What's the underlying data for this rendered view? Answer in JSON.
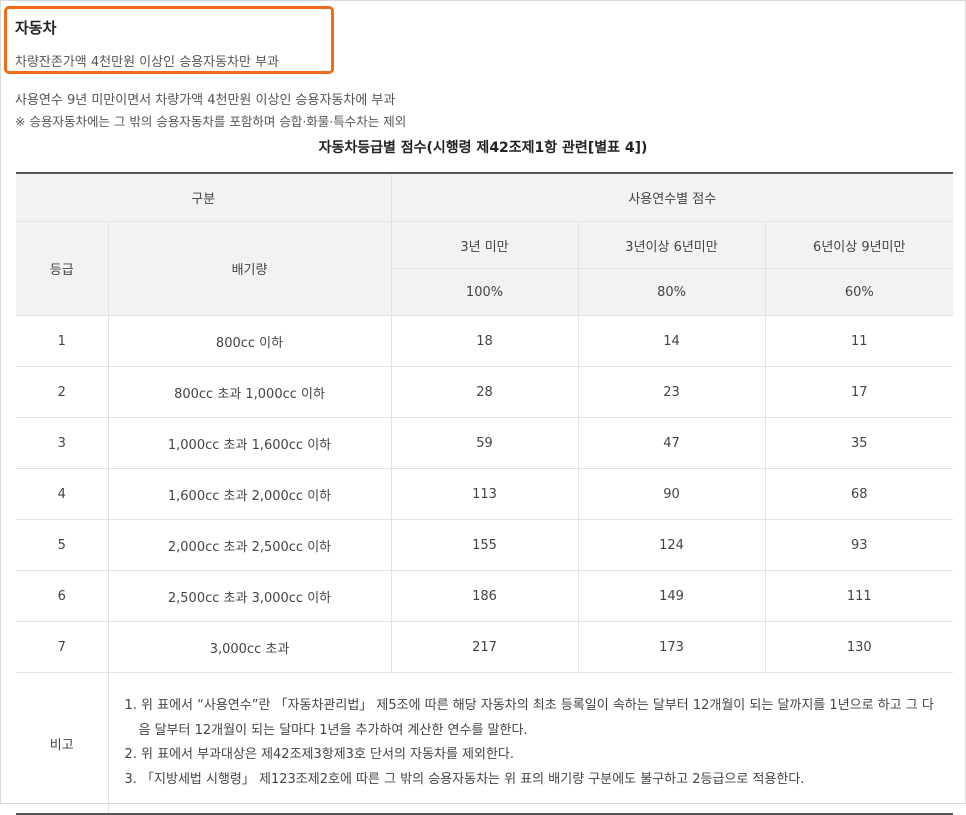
{
  "header": {
    "title": "자동차",
    "subtitle": "차량잔존가액 4천만원 이상인 승용자동차만 부과"
  },
  "description": {
    "line1": "사용연수 9년 미만이면서 차량가액 4천만원 이상인 승용자동차에 부과",
    "line2": "※ 승용자동차에는 그 밖의 승용자동차를 포함하며 승합·화물·특수차는 제외"
  },
  "table": {
    "title": "자동차등급별 점수(시행령 제42조제1항 관련[별표 4])",
    "header_category": "구분",
    "header_scores": "사용연수별 점수",
    "header_grade": "등급",
    "header_displacement": "배기량",
    "periods": [
      "3년 미만",
      "3년이상 6년미만",
      "6년이상 9년미만"
    ],
    "rates": [
      "100%",
      "80%",
      "60%"
    ],
    "rows": [
      {
        "grade": "1",
        "displacement": "800cc 이하",
        "s1": "18",
        "s2": "14",
        "s3": "11"
      },
      {
        "grade": "2",
        "displacement": "800cc 초과 1,000cc 이하",
        "s1": "28",
        "s2": "23",
        "s3": "17"
      },
      {
        "grade": "3",
        "displacement": "1,000cc 초과 1,600cc 이하",
        "s1": "59",
        "s2": "47",
        "s3": "35"
      },
      {
        "grade": "4",
        "displacement": "1,600cc 초과 2,000cc 이하",
        "s1": "113",
        "s2": "90",
        "s3": "68"
      },
      {
        "grade": "5",
        "displacement": "2,000cc 초과 2,500cc 이하",
        "s1": "155",
        "s2": "124",
        "s3": "93"
      },
      {
        "grade": "6",
        "displacement": "2,500cc 초과 3,000cc 이하",
        "s1": "186",
        "s2": "149",
        "s3": "111"
      },
      {
        "grade": "7",
        "displacement": "3,000cc 초과",
        "s1": "217",
        "s2": "173",
        "s3": "130"
      }
    ],
    "note_label": "비고",
    "notes": [
      "1. 위 표에서 “사용연수”란 「자동차관리법」 제5조에 따른 해당 자동차의 최초 등록일이 속하는 달부터 12개월이 되는 달까지를 1년으로 하고 그 다음 달부터 12개월이 되는 달마다 1년을 추가하여 계산한 연수를 말한다.",
      "2. 위 표에서 부과대상은 제42조제3항제3호 단서의 자동차를 제외한다.",
      "3. 「지방세법 시행령」 제123조제2호에 따른 그 밖의 승용자동차는 위 표의 배기량 구분에도 불구하고 2등급으로 적용한다."
    ]
  },
  "colors": {
    "highlight": "#f26b1d",
    "header_bg": "#f2f2f2"
  }
}
